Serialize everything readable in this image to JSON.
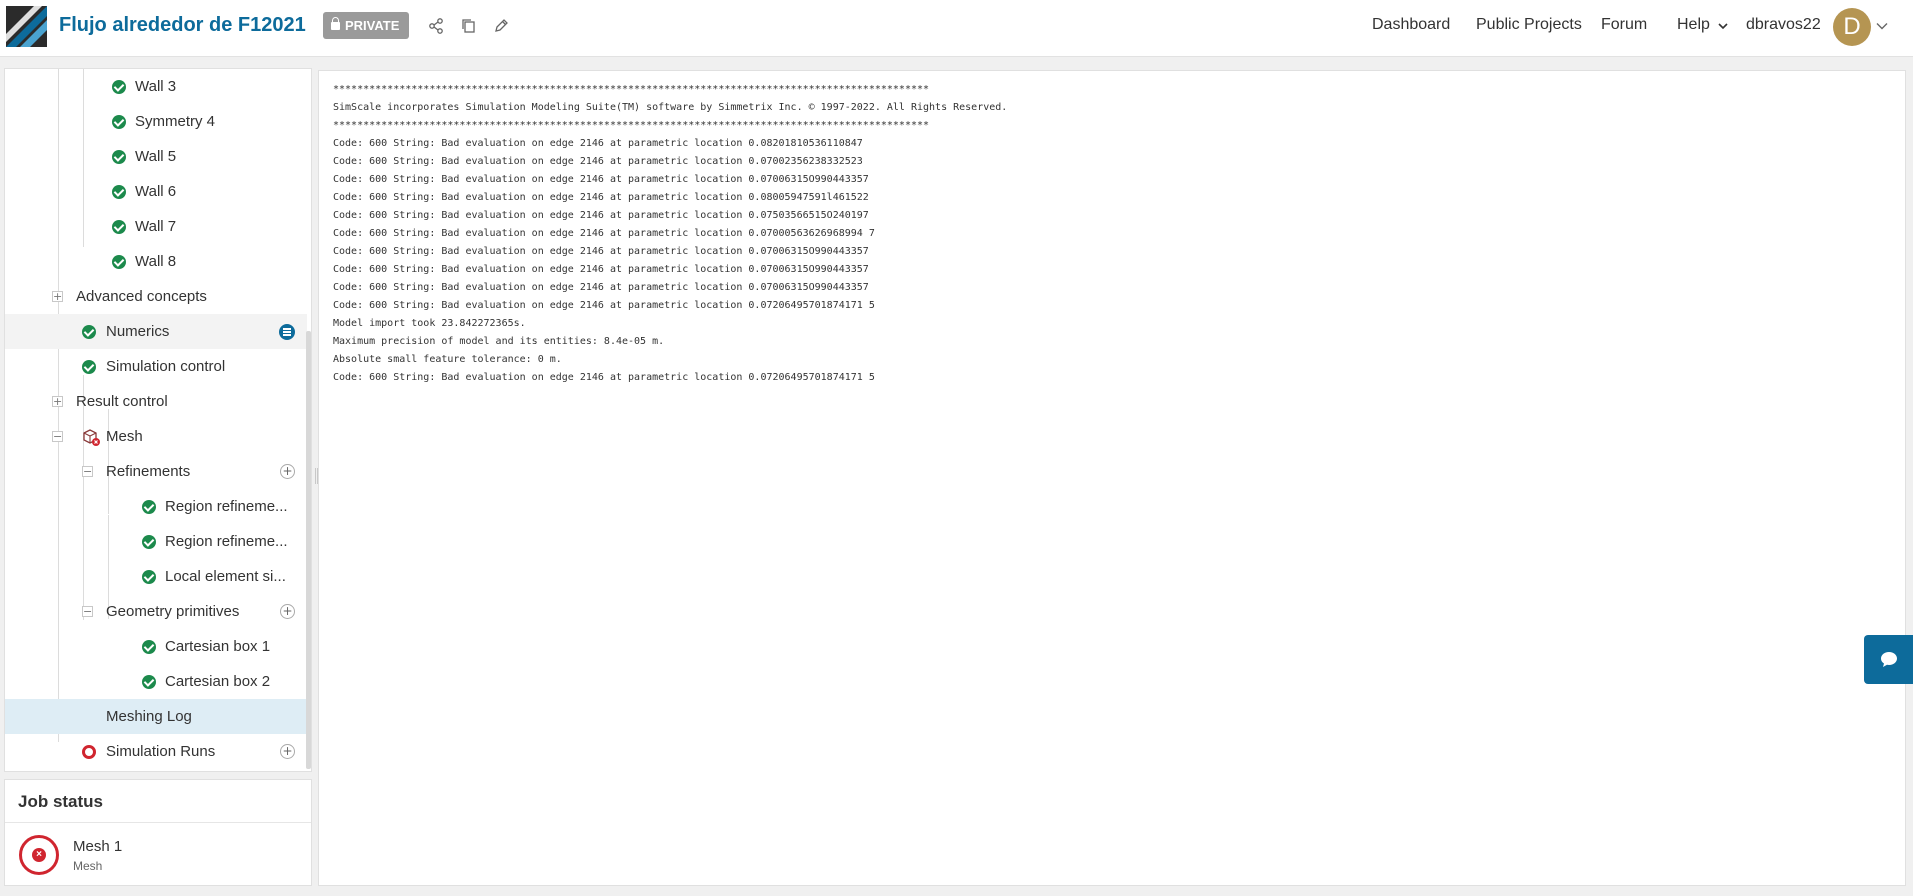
{
  "header": {
    "project_title": "Flujo alrededor de F12021",
    "private_label": "PRIVATE",
    "nav": {
      "dashboard": "Dashboard",
      "public_projects": "Public Projects",
      "forum": "Forum",
      "help": "Help"
    },
    "username": "dbravos22",
    "avatar_initial": "D",
    "icons": [
      "share-icon",
      "copy-icon",
      "edit-icon",
      "chevron-down-icon"
    ]
  },
  "tree": {
    "items": [
      {
        "label": "Wall 3",
        "status": "ok"
      },
      {
        "label": "Symmetry 4",
        "status": "ok"
      },
      {
        "label": "Wall 5",
        "status": "ok"
      },
      {
        "label": "Wall 6",
        "status": "ok"
      },
      {
        "label": "Wall 7",
        "status": "ok"
      },
      {
        "label": "Wall 8",
        "status": "ok"
      },
      {
        "label": "Advanced concepts",
        "status": "collapsed"
      },
      {
        "label": "Numerics",
        "status": "ok"
      },
      {
        "label": "Simulation control",
        "status": "ok"
      },
      {
        "label": "Result control",
        "status": "collapsed"
      },
      {
        "label": "Mesh",
        "status": "error"
      },
      {
        "label": "Refinements",
        "status": "expanded"
      },
      {
        "label": "Region refineme...",
        "status": "ok"
      },
      {
        "label": "Region refineme...",
        "status": "ok"
      },
      {
        "label": "Local element si...",
        "status": "ok"
      },
      {
        "label": "Geometry primitives",
        "status": "expanded"
      },
      {
        "label": "Cartesian box 1",
        "status": "ok"
      },
      {
        "label": "Cartesian box 2",
        "status": "ok"
      },
      {
        "label": "Meshing Log",
        "status": "selected"
      },
      {
        "label": "Simulation Runs",
        "status": "error"
      }
    ]
  },
  "job_status": {
    "title": "Job status",
    "job_name": "Mesh 1",
    "job_type": "Mesh"
  },
  "log": {
    "lines": [
      "***************************************************************************************************",
      "SimScale incorporates Simulation Modeling Suite(TM) software by Simmetrix Inc. © 1997-2022. All Rights Reserved.",
      "***************************************************************************************************",
      "Code: 600 String: Bad evaluation on edge 2146 at parametric location 0.08201810536110847",
      "Code: 600 String: Bad evaluation on edge 2146 at parametric location 0.07002356238332523",
      "Code: 600 String: Bad evaluation on edge 2146 at parametric location 0.07006315O990443357",
      "Code: 600 String: Bad evaluation on edge 2146 at parametric location 0.08005947591l461522",
      "Code: 600 String: Bad evaluation on edge 2146 at parametric location 0.07503566515O240197",
      "Code: 600 String: Bad evaluation on edge 2146 at parametric location 0.07000563626968994 7",
      "Code: 600 String: Bad evaluation on edge 2146 at parametric location 0.07006315O990443357",
      "Code: 600 String: Bad evaluation on edge 2146 at parametric location 0.07006315O990443357",
      "Code: 600 String: Bad evaluation on edge 2146 at parametric location 0.07006315O990443357",
      "Code: 600 String: Bad evaluation on edge 2146 at parametric location 0.07206495701874171 5",
      "Model import took 23.842272365s.",
      "Maximum precision of model and its entities: 8.4e-05 m.",
      "Absolute small feature tolerance: 0 m.",
      "Code: 600 String: Bad evaluation on edge 2146 at parametric location 0.07206495701874171 5"
    ]
  },
  "colors": {
    "brand": "#0d6b9b",
    "ok": "#1c8a4c",
    "error": "#d0252f",
    "avatar": "#b59552",
    "selected_row": "#deedf5"
  }
}
